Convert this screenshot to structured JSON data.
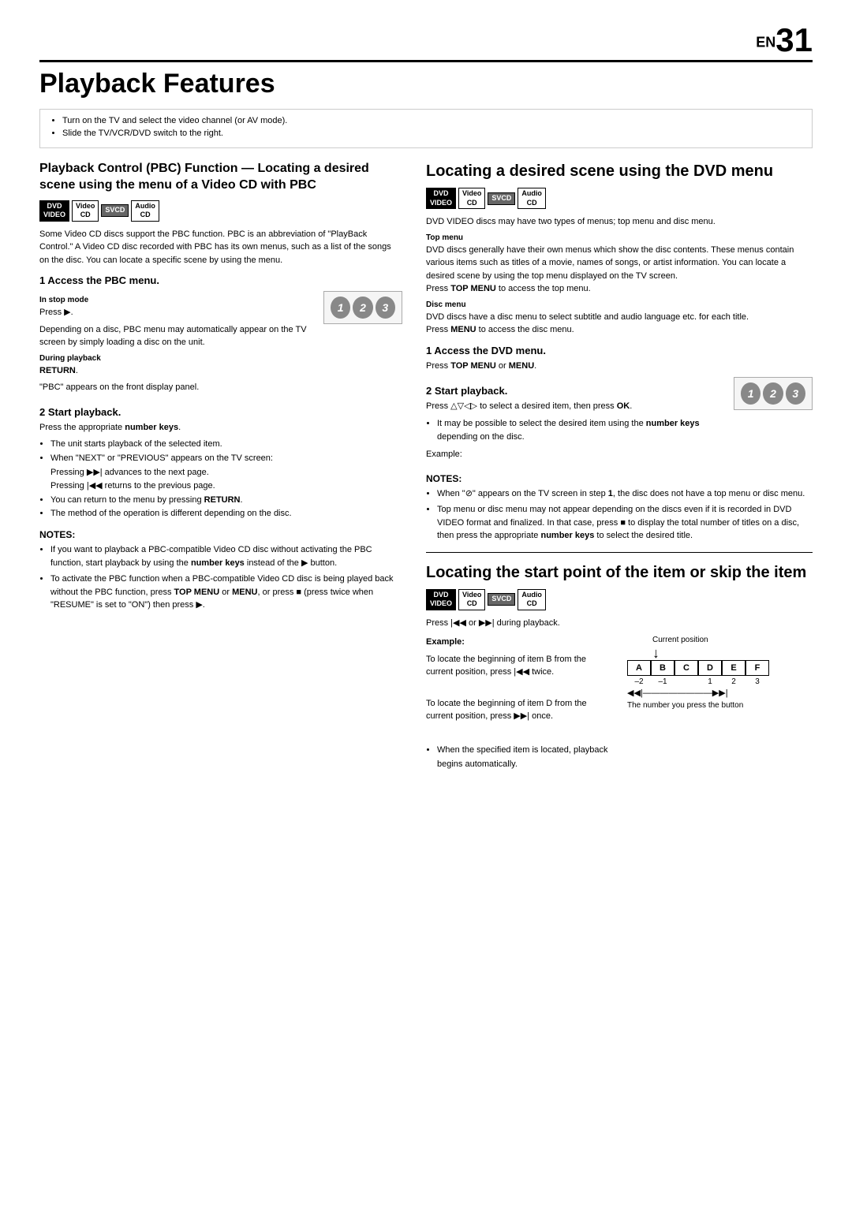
{
  "header": {
    "en_label": "EN",
    "page_number": "31"
  },
  "page_title": "Playback Features",
  "intro": {
    "bullets": [
      "Turn on the TV and select the video channel (or AV mode).",
      "Slide the TV/VCR/DVD switch to the right."
    ]
  },
  "left": {
    "section1_title": "Playback Control (PBC) Function — Locating a desired scene using the menu of a Video CD with PBC",
    "badges": [
      "DVD VIDEO",
      "Video CD",
      "SVCD",
      "Audio CD"
    ],
    "section1_intro": "Some Video CD discs support the PBC function. PBC is an abbreviation of \"PlayBack Control.\" A Video CD disc recorded with PBC has its own menus, such as a list of the songs on the disc. You can locate a specific scene by using the menu.",
    "step1_title": "1   Access the PBC menu.",
    "in_stop_mode_label": "In stop mode",
    "in_stop_mode_text": "Press ▶.",
    "in_stop_mode_note": "Depending on a disc, PBC menu may automatically appear on the TV screen by simply loading a disc on the unit.",
    "during_playback_label": "During playback",
    "during_playback_text": "Press RETURN.",
    "during_playback_note": "\"PBC\" appears on the front display panel.",
    "step2_title": "2   Start playback.",
    "step2_text": "Press the appropriate number keys.",
    "step2_bullets": [
      "The unit starts playback of the selected item.",
      "When \"NEXT\" or \"PREVIOUS\" appears on the TV screen: Pressing ▶▶| advances to the next page. Pressing |◀◀ returns to the previous page.",
      "You can return to the menu by pressing RETURN.",
      "The method of the operation is different depending on the disc."
    ],
    "notes_title": "NOTES:",
    "notes_bullets": [
      "If you want to playback a PBC-compatible Video CD disc without activating the PBC function, start playback by using the number keys instead of the ▶ button.",
      "To activate the PBC function when a PBC-compatible Video CD disc is being played back without the PBC function, press TOP MENU or MENU, or press ■ (press twice when \"RESUME\" is set to \"ON\") then press ▶."
    ]
  },
  "right": {
    "section2_title": "Locating a desired scene using the DVD menu",
    "badges": [
      "DVD VIDEO",
      "Video CD",
      "SVCD",
      "Audio CD"
    ],
    "section2_intro": "DVD VIDEO discs may have two types of menus; top menu and disc menu.",
    "top_menu_label": "Top menu",
    "top_menu_text": "DVD discs generally have their own menus which show the disc contents. These menus contain various items such as titles of a movie, names of songs, or artist information. You can locate a desired scene by using the top menu displayed on the TV screen. Press TOP MENU to access the top menu.",
    "disc_menu_label": "Disc menu",
    "disc_menu_text": "DVD discs have a disc menu to select subtitle and audio language etc. for each title. Press MENU to access the disc menu.",
    "step1_title": "1   Access the DVD menu.",
    "step1_text": "Press TOP MENU or MENU.",
    "step2_title": "2   Start playback.",
    "step2_text": "Press △▽◁▷ to select a desired item, then press OK.",
    "step2_note": "It may be possible to select the desired item using the number keys depending on the disc.",
    "example_label": "Example:",
    "notes_title": "NOTES:",
    "notes_bullets": [
      "When \"⊘\" appears on the TV screen in step 1, the disc does not have a top menu or disc menu.",
      "Top menu or disc menu may not appear depending on the discs even if it is recorded in DVD VIDEO format and finalized. In that case, press ■ to display the total number of titles on a disc, then press the appropriate number keys to select the desired title."
    ],
    "section3_title": "Locating the start point of the item or skip the item",
    "section3_badges": [
      "DVD VIDEO",
      "Video CD",
      "SVCD",
      "Audio CD"
    ],
    "section3_intro": "Press |◀◀ or ▶▶| during playback.",
    "example2_label": "Example:",
    "current_position_label": "Current position",
    "diagram_text1": "To locate the beginning of item B from the current position, press |◀◀ twice.",
    "diagram_text2": "To locate the beginning of item D from the current position, press ▶▶| once.",
    "diagram_text3": "When the specified item is located, playback begins automatically.",
    "diagram_cells": [
      "A",
      "B",
      "C",
      "D",
      "E",
      "F"
    ],
    "diagram_numbers": [
      "-2",
      "-1",
      "",
      "1",
      "2",
      "3"
    ],
    "the_number_label": "The number you press the button"
  }
}
